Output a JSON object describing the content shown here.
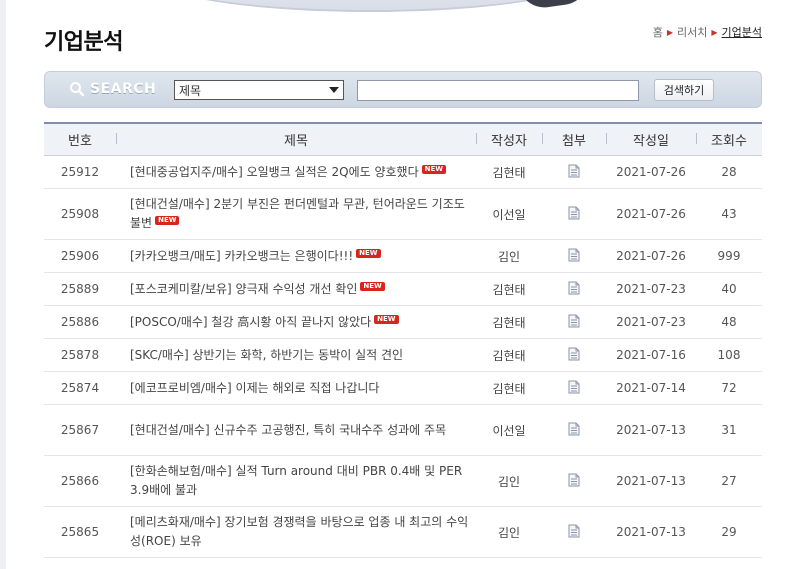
{
  "page": {
    "title": "기업분석"
  },
  "breadcrumb": {
    "home": "홈",
    "research": "리서치",
    "current": "기업분석"
  },
  "search": {
    "label": "SEARCH",
    "field_selected": "제목",
    "query_value": "",
    "button_label": "검색하기"
  },
  "table": {
    "headers": {
      "num": "번호",
      "title": "제목",
      "author": "작성자",
      "attach": "첨부",
      "date": "작성일",
      "views": "조회수"
    },
    "rows": [
      {
        "num": "25912",
        "title": "[현대중공업지주/매수] 오일뱅크 실적은 2Q에도 양호했다",
        "new": "NEW",
        "author": "김현태",
        "attach_icon": "document-icon",
        "date": "2021-07-26",
        "views": "28"
      },
      {
        "num": "25908",
        "title": "[현대건설/매수] 2분기 부진은 펀더멘털과 무관, 턴어라운드 기조도 불변",
        "new": "NEW",
        "author": "이선일",
        "attach_icon": "document-icon",
        "date": "2021-07-26",
        "views": "43"
      },
      {
        "num": "25906",
        "title": "[카카오뱅크/매도] 카카오뱅크는 은행이다!!!",
        "new": "NEW",
        "author": "김인",
        "attach_icon": "document-icon",
        "date": "2021-07-26",
        "views": "999"
      },
      {
        "num": "25889",
        "title": "[포스코케미칼/보유] 양극재 수익성 개선 확인",
        "new": "NEW",
        "author": "김현태",
        "attach_icon": "document-icon",
        "date": "2021-07-23",
        "views": "40"
      },
      {
        "num": "25886",
        "title": "[POSCO/매수] 철강 高시황 아직 끝나지 않았다",
        "new": "NEW",
        "author": "김현태",
        "attach_icon": "document-icon",
        "date": "2021-07-23",
        "views": "48"
      },
      {
        "num": "25878",
        "title": "[SKC/매수] 상반기는 화학, 하반기는 동박이 실적 견인",
        "new": "",
        "author": "김현태",
        "attach_icon": "document-icon",
        "date": "2021-07-16",
        "views": "108"
      },
      {
        "num": "25874",
        "title": "[에코프로비엠/매수] 이제는 해외로 직접 나갑니다",
        "new": "",
        "author": "김현태",
        "attach_icon": "document-icon",
        "date": "2021-07-14",
        "views": "72"
      },
      {
        "num": "25867",
        "title": "[현대건설/매수] 신규수주 고공행진, 특히 국내수주 성과에 주목",
        "new": "",
        "author": "이선일",
        "attach_icon": "document-icon",
        "date": "2021-07-13",
        "views": "31"
      },
      {
        "num": "25866",
        "title": "[한화손해보험/매수] 실적 Turn around 대비 PBR 0.4배 및 PER 3.9배에 불과",
        "new": "",
        "author": "김인",
        "attach_icon": "document-icon",
        "date": "2021-07-13",
        "views": "27"
      },
      {
        "num": "25865",
        "title": "[메리츠화재/매수] 장기보험 경쟁력을 바탕으로 업종 내 최고의 수익성(ROE) 보유",
        "new": "",
        "author": "김인",
        "attach_icon": "document-icon",
        "date": "2021-07-13",
        "views": "29"
      }
    ]
  },
  "colors": {
    "header_border": "#7f8fa9",
    "header_bg": "#eff2f7",
    "new_badge": "#d7261e",
    "search_bar": "#dfe6ee"
  }
}
